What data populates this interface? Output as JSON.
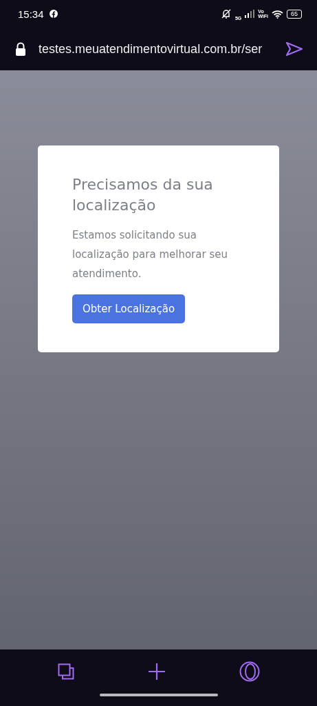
{
  "status_bar": {
    "time": "15:34",
    "network": "5G",
    "vowifi_top": "Vo",
    "vowifi_bottom": "WiFi",
    "battery": "65"
  },
  "address_bar": {
    "url": "testes.meuatendimentovirtual.com.br/ser"
  },
  "card": {
    "title": "Precisamos da sua localização",
    "text": "Estamos solicitando sua localização para melhorar seu atendimento.",
    "button": "Obter Localização"
  },
  "bottom_nav": [
    {
      "kind": "tabs"
    },
    {
      "kind": "new"
    },
    {
      "kind": "menu"
    }
  ]
}
